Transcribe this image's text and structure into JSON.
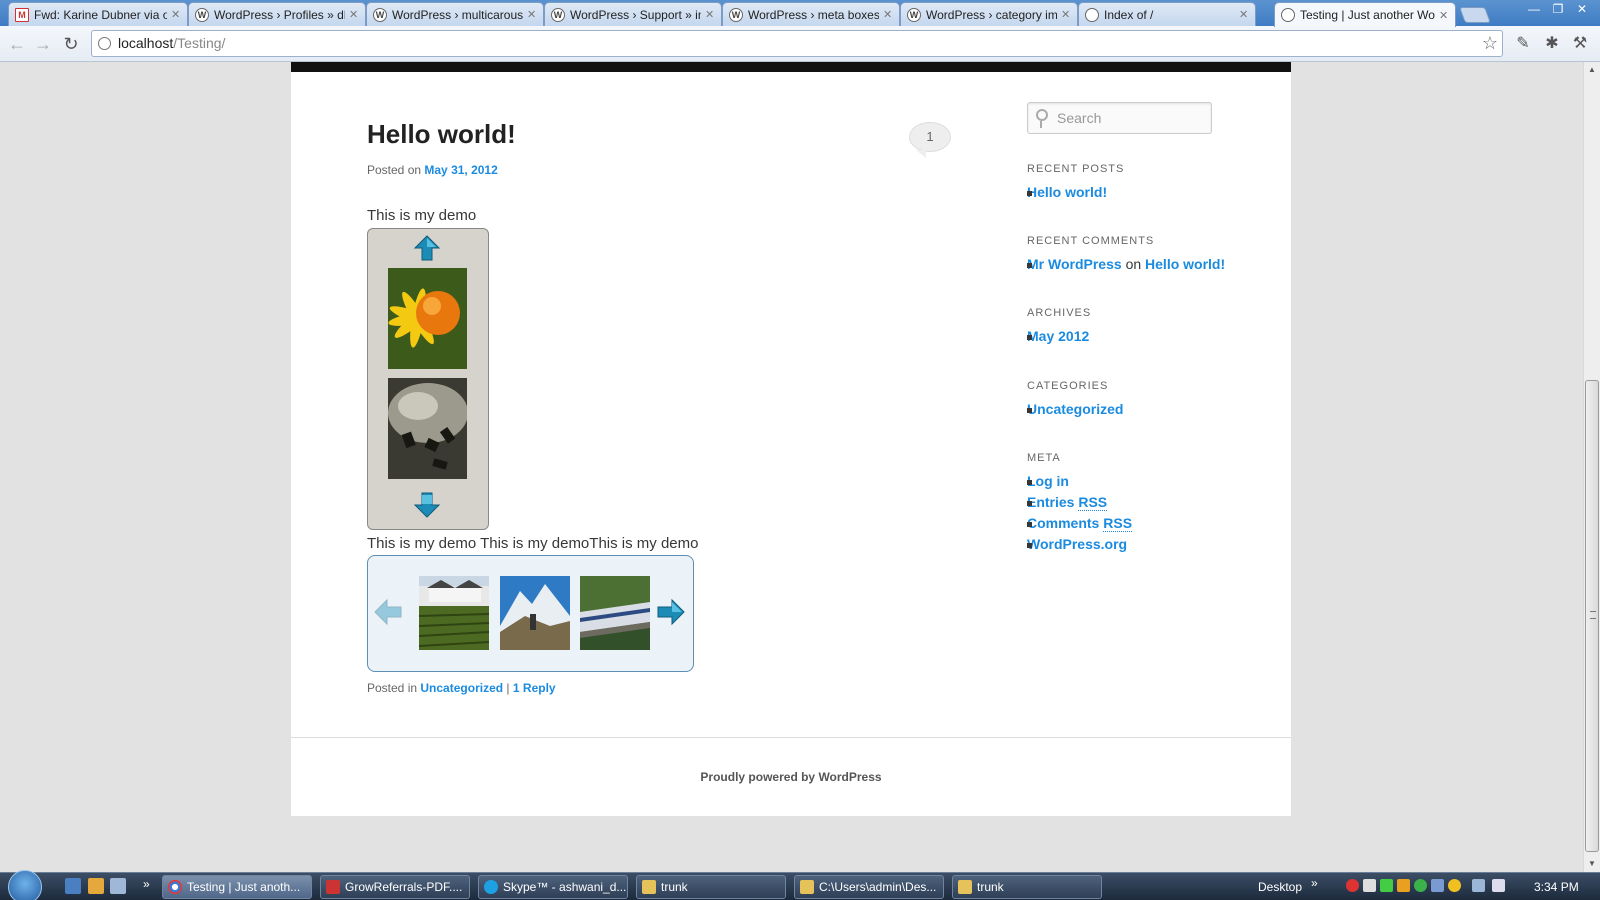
{
  "browser": {
    "tabs": [
      {
        "title": "Fwd: Karine Dubner via o",
        "icon": "gmail-icon"
      },
      {
        "title": "WordPress › Profiles » dh",
        "icon": "wordpress-icon"
      },
      {
        "title": "WordPress › multicarousel",
        "icon": "wordpress-icon"
      },
      {
        "title": "WordPress › Support » im",
        "icon": "wordpress-icon"
      },
      {
        "title": "WordPress › meta boxes",
        "icon": "wordpress-icon"
      },
      {
        "title": "WordPress › category ima",
        "icon": "wordpress-icon"
      },
      {
        "title": "Index of /",
        "icon": "page-icon"
      },
      {
        "title": "Testing | Just another Wo",
        "icon": "page-icon"
      }
    ],
    "address": {
      "host": "localhost",
      "path": "/Testing/"
    }
  },
  "post": {
    "title": "Hello world!",
    "comment_count": "1",
    "posted_on_label": "Posted on",
    "date": "May 31, 2012",
    "text1": "This is my demo",
    "text2": "This is my demo This is my demoThis is my demo",
    "meta_posted_in": "Posted in",
    "category": "Uncategorized",
    "separator": "|",
    "reply": "1 Reply"
  },
  "sidebar": {
    "search_placeholder": "Search",
    "recent_posts_title": "Recent Posts",
    "recent_posts": [
      "Hello world!"
    ],
    "recent_comments_title": "Recent Comments",
    "recent_comment": {
      "author": "Mr WordPress",
      "on": "on",
      "post": "Hello world!"
    },
    "archives_title": "Archives",
    "archives": [
      "May 2012"
    ],
    "categories_title": "Categories",
    "categories": [
      "Uncategorized"
    ],
    "meta_title": "Meta",
    "meta": {
      "login": "Log in",
      "entries": "Entries",
      "comments": "Comments",
      "rss": "RSS",
      "wporg": "WordPress.org"
    }
  },
  "footer": {
    "text": "Proudly powered by WordPress"
  },
  "taskbar": {
    "tasks": [
      "Testing | Just anoth...",
      "GrowReferrals-PDF....",
      "Skype™ - ashwani_d...",
      "trunk",
      "C:\\Users\\admin\\Des...",
      "trunk"
    ],
    "desktop_label": "Desktop",
    "time": "3:34 PM"
  },
  "colors": {
    "link": "#1b8be0",
    "carousel_arrow": "#1c8cb7"
  }
}
